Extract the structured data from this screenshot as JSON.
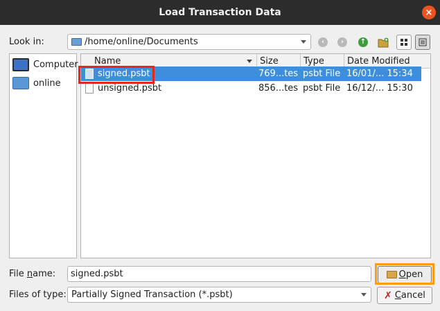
{
  "window": {
    "title": "Load Transaction Data",
    "close_glyph": "×"
  },
  "toolbar": {
    "look_in_label": "Look in:",
    "current_path": "/home/online/Documents",
    "icons": [
      "back-icon",
      "forward-icon",
      "parent-directory-icon",
      "new-folder-icon",
      "list-view-icon",
      "detail-view-icon"
    ]
  },
  "sidebar": {
    "items": [
      {
        "label": "Computer",
        "icon": "computer-icon"
      },
      {
        "label": "online",
        "icon": "folder-icon"
      }
    ]
  },
  "file_list": {
    "columns": [
      "Name",
      "Size",
      "Type",
      "Date Modified"
    ],
    "sort_column": "Name",
    "rows": [
      {
        "name": "signed.psbt",
        "size": "769...tes",
        "type": "psbt File",
        "date": "16/01/... 15:34",
        "selected": true
      },
      {
        "name": "unsigned.psbt",
        "size": "856...tes",
        "type": "psbt File",
        "date": "16/12/... 15:30",
        "selected": false
      }
    ]
  },
  "footer": {
    "file_name_label_pre": "File ",
    "file_name_label_u": "n",
    "file_name_label_post": "ame:",
    "file_name_value": "signed.psbt",
    "file_type_label": "Files of type:",
    "file_type_value": "Partially Signed Transaction (*.psbt)",
    "open_u": "O",
    "open_rest": "pen",
    "cancel_u": "C",
    "cancel_rest": "ancel",
    "cancel_glyph": "✗"
  },
  "colors": {
    "accent_selection": "#3d8edb",
    "close_button": "#e95420",
    "highlight_red": "#e8241b",
    "highlight_orange": "#ff9a13"
  }
}
